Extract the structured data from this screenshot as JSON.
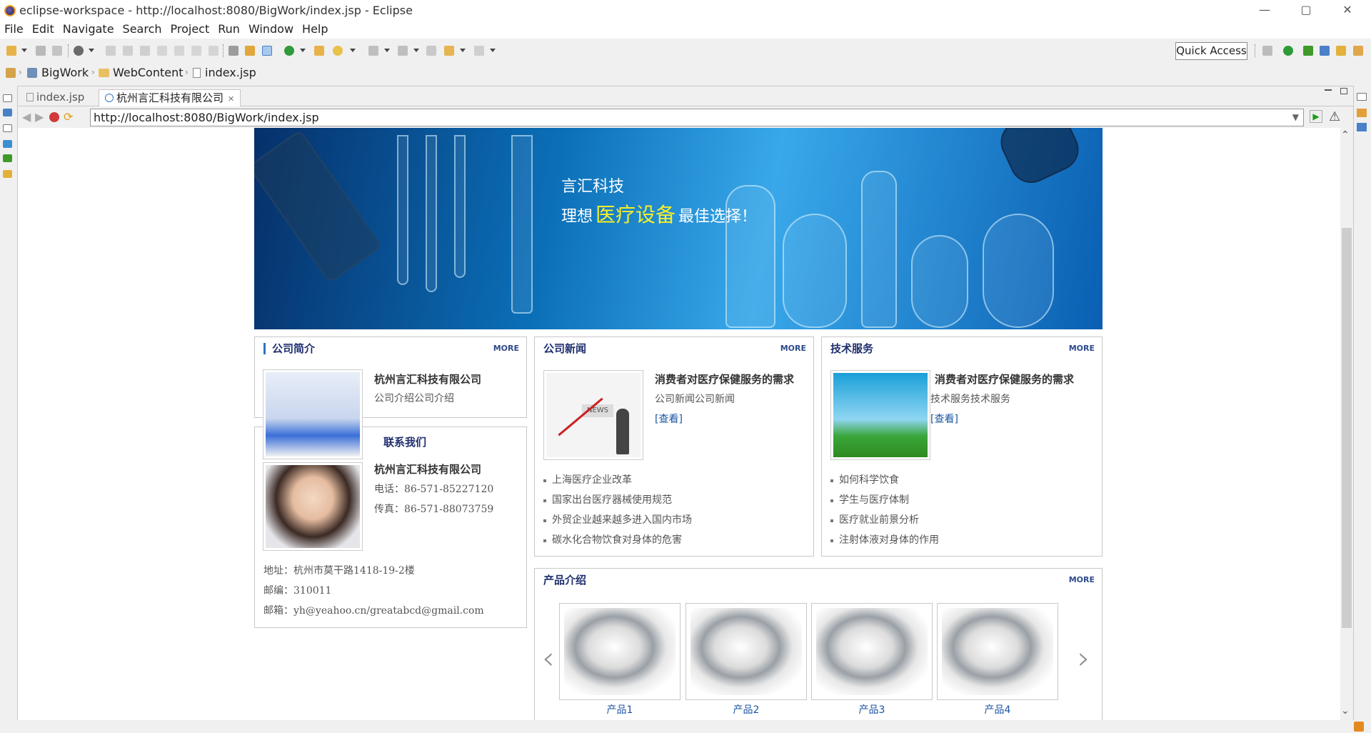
{
  "window": {
    "title": "eclipse-workspace - http://localhost:8080/BigWork/index.jsp - Eclipse",
    "min": "—",
    "max": "▢",
    "close": "✕"
  },
  "menu": [
    "File",
    "Edit",
    "Navigate",
    "Search",
    "Project",
    "Run",
    "Window",
    "Help"
  ],
  "toolbar": {
    "quick_access": "Quick Access"
  },
  "breadcrumb": {
    "project": "BigWork",
    "folder": "WebContent",
    "file": "index.jsp"
  },
  "editor_tabs": [
    {
      "label": "index.jsp"
    },
    {
      "label": "杭州言汇科技有限公司",
      "close": "✕"
    }
  ],
  "browser": {
    "url": "http://localhost:8080/BigWork/index.jsp"
  },
  "banner": {
    "brand": "言汇科技",
    "line_prefix": "理想",
    "line_highlight": "医疗设备",
    "line_suffix": "最佳选择！"
  },
  "about": {
    "title": "公司简介",
    "more": "MORE",
    "company": "杭州言汇科技有限公司",
    "desc": "公司介绍公司介绍"
  },
  "contact": {
    "title": "联系我们",
    "company": "杭州言汇科技有限公司",
    "phone": "电话：86-571-85227120",
    "fax": "传真：86-571-88073759",
    "address": "地址：杭州市莫干路1418-19-2楼",
    "zip": "邮编：310011",
    "email": "邮箱：yh@yeahoo.cn/greatabcd@gmail.com"
  },
  "news": {
    "title": "公司新闻",
    "more": "MORE",
    "headline": "消费者对医疗保健服务的需求",
    "summary": "公司新闻公司新闻",
    "view": "[查看]",
    "news_badge": "NEWS",
    "items": [
      "上海医疗企业改革",
      "国家出台医疗器械使用规范",
      "外贸企业越来越多进入国内市场",
      "碳水化合物饮食对身体的危害"
    ]
  },
  "tech": {
    "title": "技术服务",
    "more": "MORE",
    "headline": "消费者对医疗保健服务的需求",
    "summary": "技术服务技术服务",
    "view": "[查看]",
    "items": [
      "如何科学饮食",
      "学生与医疗体制",
      "医疗就业前景分析",
      "注射体液对身体的作用"
    ]
  },
  "products": {
    "title": "产品介绍",
    "more": "MORE",
    "items": [
      "产品1",
      "产品2",
      "产品3",
      "产品4"
    ],
    "prev": "‹",
    "next": "›"
  }
}
